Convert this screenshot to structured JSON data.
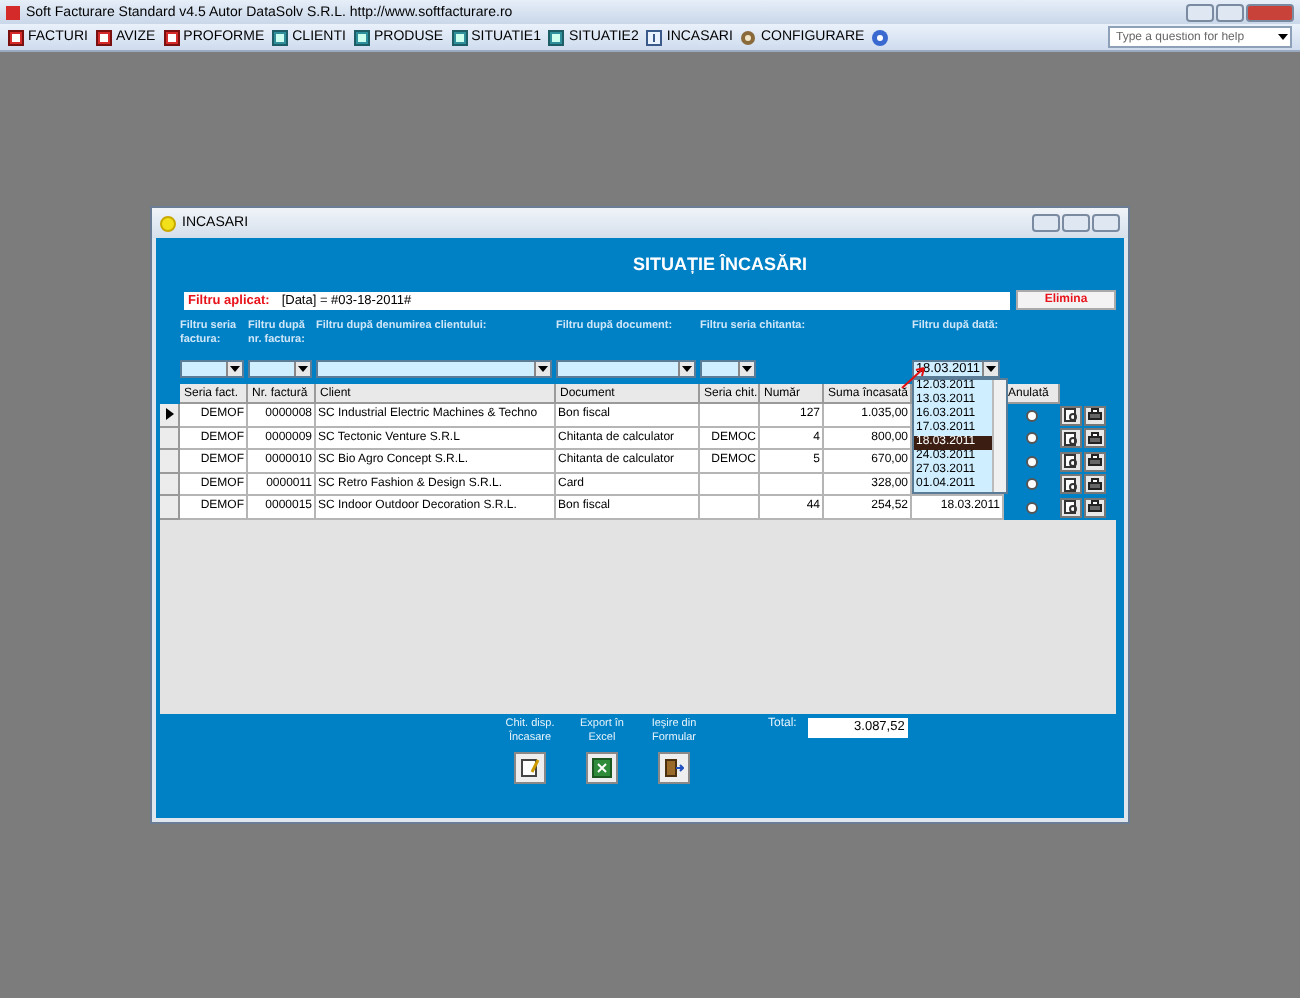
{
  "app": {
    "title": "Soft Facturare Standard v4.5 Autor DataSolv S.R.L. http://www.softfacturare.ro"
  },
  "toolbar": [
    {
      "label": "FACTURI",
      "kind": "doc"
    },
    {
      "label": "AVIZE",
      "kind": "doc"
    },
    {
      "label": "PROFORME",
      "kind": "doc"
    },
    {
      "label": "CLIENTI",
      "kind": "list"
    },
    {
      "label": "PRODUSE",
      "kind": "list"
    },
    {
      "label": "SITUATIE1",
      "kind": "list"
    },
    {
      "label": "SITUATIE2",
      "kind": "list"
    },
    {
      "label": "INCASARI",
      "kind": "info"
    },
    {
      "label": "CONFIGURARE",
      "kind": "gear"
    }
  ],
  "help": {
    "placeholder": "Type a question for help"
  },
  "form": {
    "window_title": "INCASARI",
    "heading": "SITUAȚIE ÎNCASĂRI",
    "filter_label": "Filtru aplicat:",
    "filter_value": "[Data] = #03-18-2011#",
    "remove_button": "Elimina"
  },
  "filters": [
    {
      "label": "Filtru seria factura:"
    },
    {
      "label": "Filtru după nr. factura:"
    },
    {
      "label": "Filtru după denumirea clientului:"
    },
    {
      "label": "Filtru după document:"
    },
    {
      "label": "Filtru seria chitanta:"
    }
  ],
  "date_filter": {
    "label": "Filtru după dată:",
    "value": "18.03.2011",
    "expanded": true
  },
  "date_options": [
    {
      "label": "12.03.2011",
      "selected": false
    },
    {
      "label": "13.03.2011",
      "selected": false
    },
    {
      "label": "16.03.2011",
      "selected": false
    },
    {
      "label": "17.03.2011",
      "selected": false
    },
    {
      "label": "18.03.2011",
      "selected": true
    },
    {
      "label": "24.03.2011",
      "selected": false
    },
    {
      "label": "27.03.2011",
      "selected": false
    },
    {
      "label": "01.04.2011",
      "selected": false
    }
  ],
  "columns": [
    "Seria fact.",
    "Nr. factură",
    "Client",
    "Document",
    "Seria chit.",
    "Număr",
    "Suma încasată"
  ],
  "cancel_column": "Anulată",
  "rows": [
    {
      "current": true,
      "seria": "DEMOF",
      "nr": "0000008",
      "client": "SC Industrial Electric Machines & Techno",
      "document": "Bon fiscal",
      "numar": "127",
      "suma": "1.035,00",
      "anulata": false
    },
    {
      "current": false,
      "seria": "DEMOF",
      "nr": "0000009",
      "client": "SC Tectonic Venture S.R.L",
      "document": "Chitanta de calculator",
      "seria_chit": "DEMOC",
      "numar": "4",
      "suma": "800,00",
      "anulata": false
    },
    {
      "current": false,
      "seria": "DEMOF",
      "nr": "0000010",
      "client": "SC Bio Agro Concept S.R.L.",
      "document": "Chitanta de calculator",
      "seria_chit": "DEMOC",
      "numar": "5",
      "suma": "670,00",
      "anulata": false
    },
    {
      "current": false,
      "seria": "DEMOF",
      "nr": "0000011",
      "client": "SC Retro Fashion & Design S.R.L.",
      "document": "Card",
      "suma": "328,00",
      "anulata": false
    },
    {
      "current": false,
      "seria": "DEMOF",
      "nr": "0000015",
      "client": "SC Indoor Outdoor Decoration S.R.L.",
      "document": "Bon fiscal",
      "numar": "44",
      "suma": "254,52",
      "data": "18.03.2011",
      "anulata": false
    }
  ],
  "total": {
    "label": "Total:",
    "value": "3.087,52"
  },
  "actions": [
    {
      "label": "Chit. disp. Încasare",
      "kind": "edit"
    },
    {
      "label": "Export în Excel",
      "kind": "excel"
    },
    {
      "label": "Ieşire din Formular",
      "kind": "exit"
    }
  ]
}
